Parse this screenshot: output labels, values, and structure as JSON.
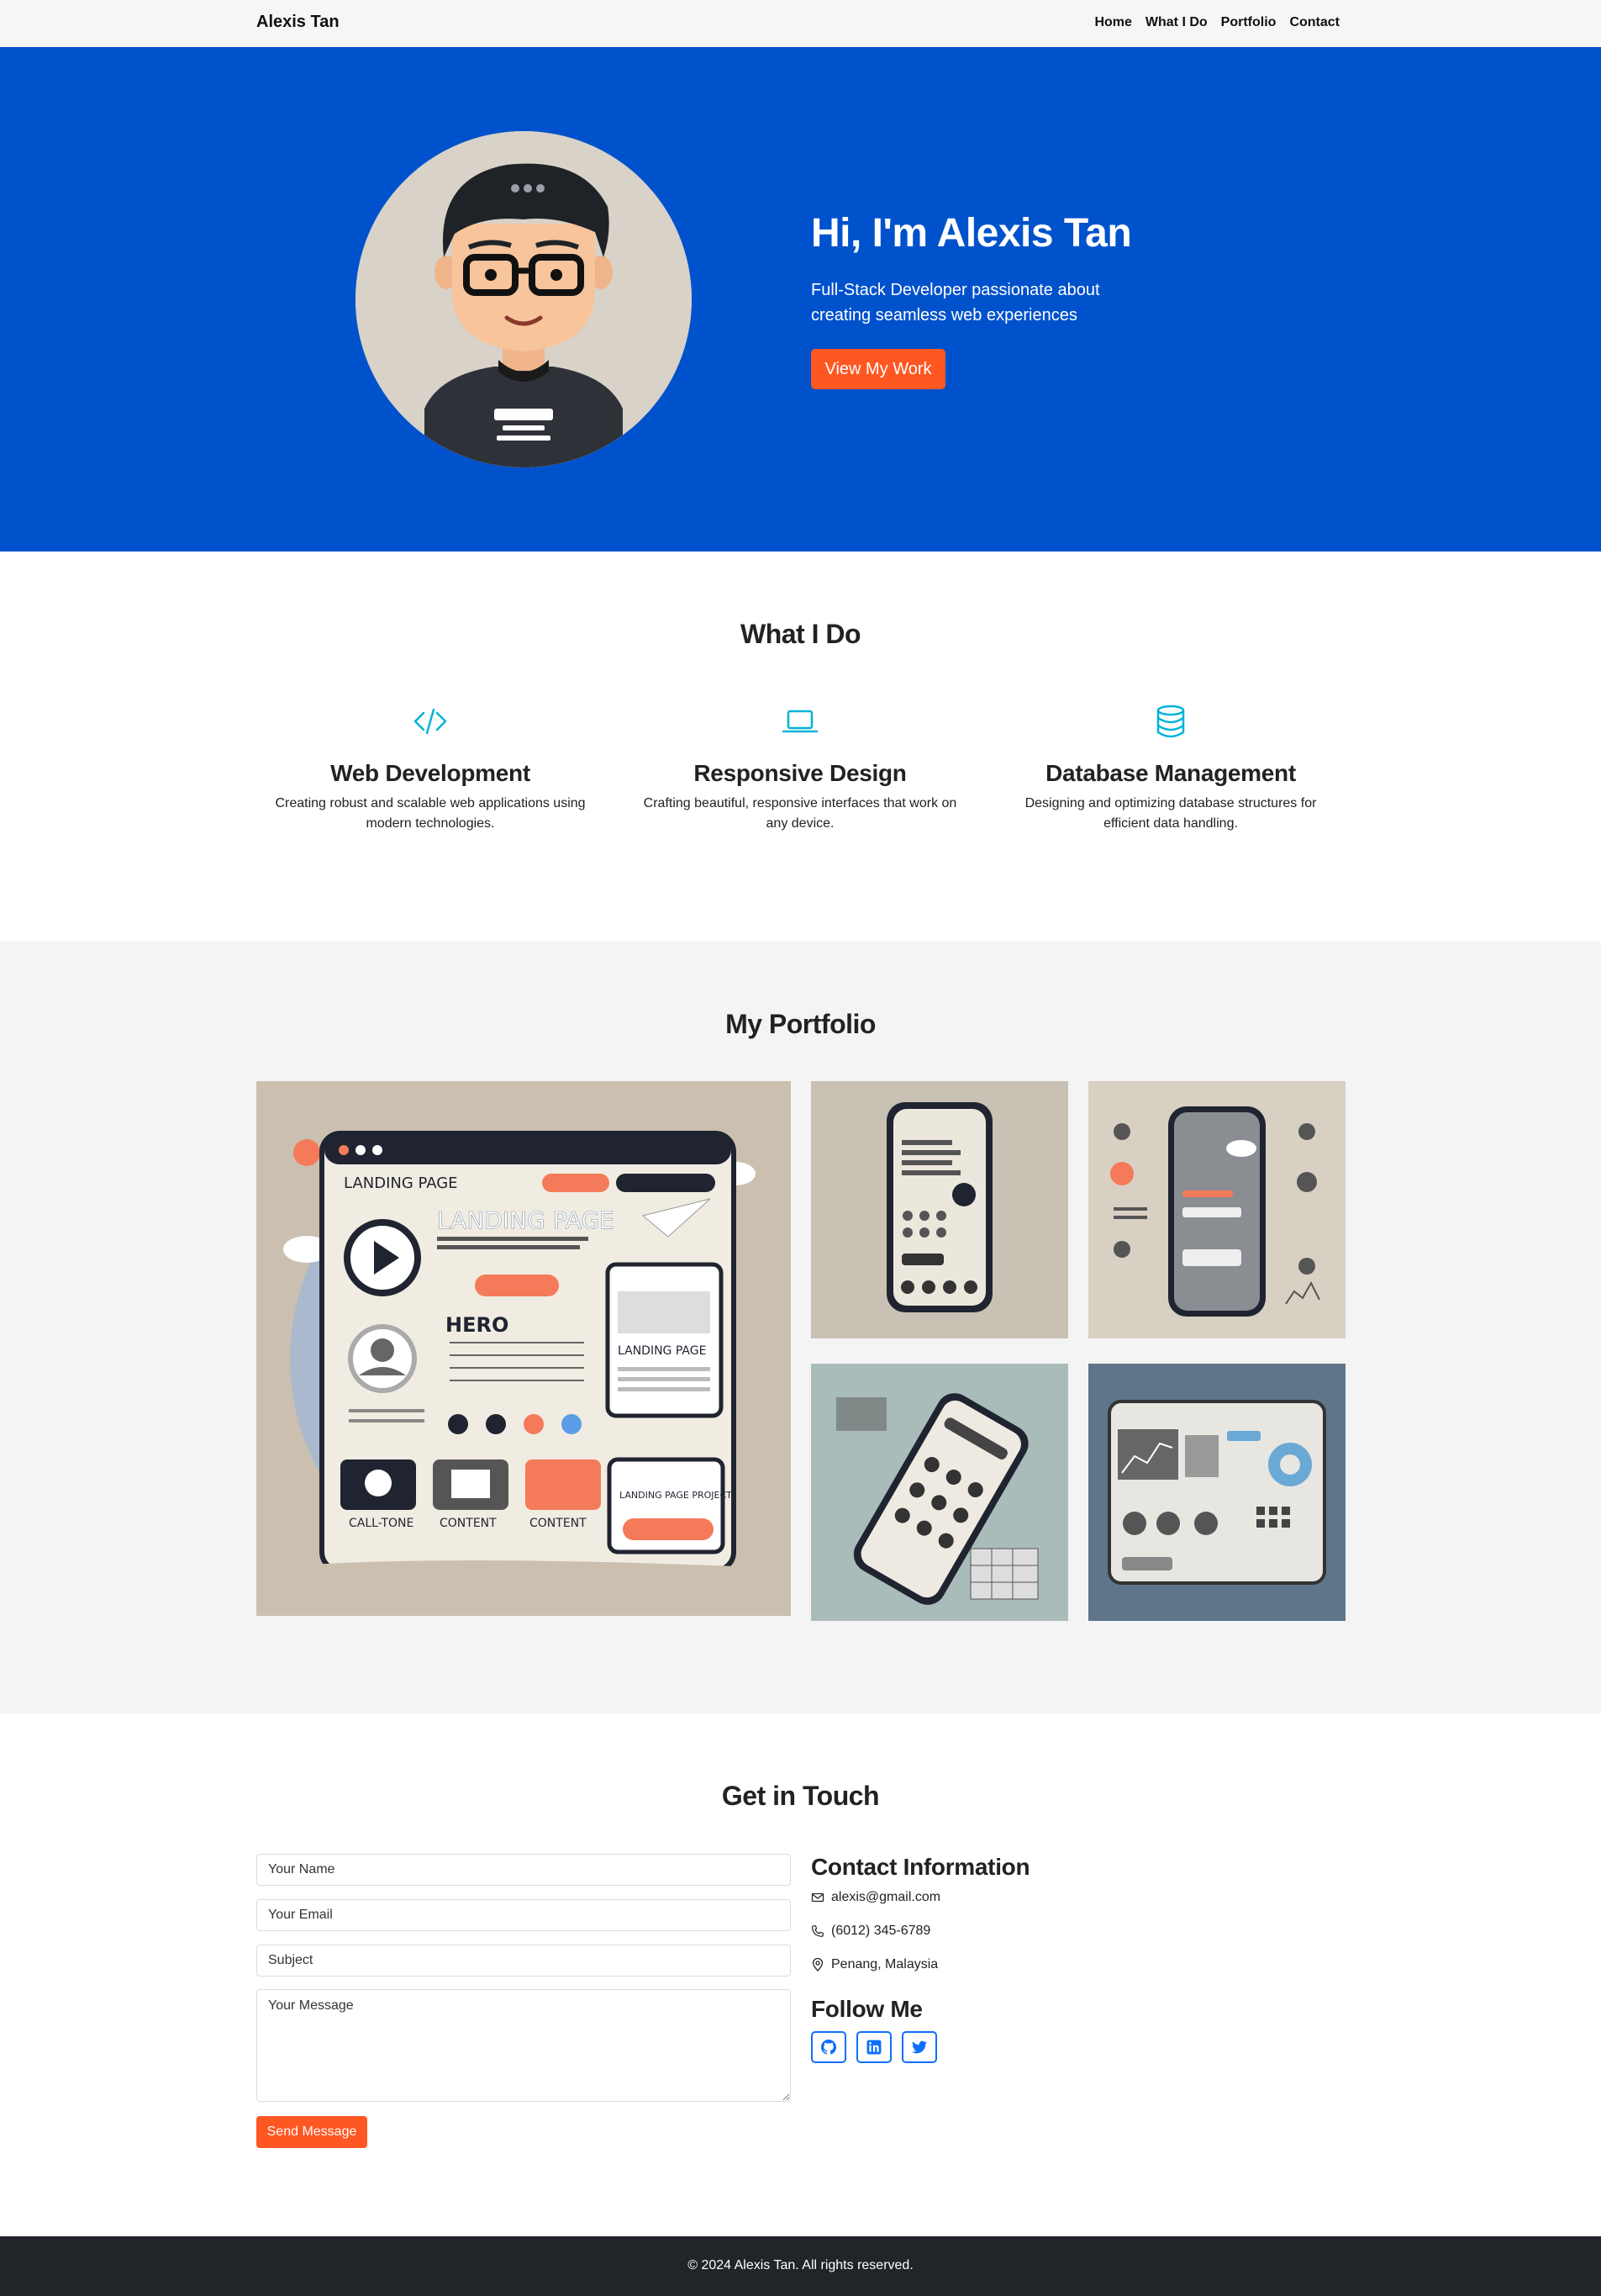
{
  "nav": {
    "brand": "Alexis Tan",
    "links": [
      "Home",
      "What I Do",
      "Portfolio",
      "Contact"
    ]
  },
  "hero": {
    "title": "Hi, I'm Alexis Tan",
    "subtitle": "Full-Stack Developer passionate about creating seamless web experiences",
    "button": "View My Work",
    "avatar_icon": "developer-avatar-illustration"
  },
  "services": {
    "title": "What I Do",
    "items": [
      {
        "icon": "code-icon",
        "title": "Web Development",
        "text": "Creating robust and scalable web applications using modern technologies."
      },
      {
        "icon": "laptop-icon",
        "title": "Responsive Design",
        "text": "Crafting beautiful, responsive interfaces that work on any device."
      },
      {
        "icon": "database-icon",
        "title": "Database Management",
        "text": "Designing and optimizing database structures for efficient data handling."
      }
    ]
  },
  "portfolio": {
    "title": "My Portfolio",
    "items": [
      {
        "name": "landing-page-project",
        "text": [
          "LANDING PAGE",
          "HERO",
          "CONTENT",
          "CONTENT",
          "LANDING PAGE PROJECT"
        ]
      },
      {
        "name": "mobile-app-ui-1",
        "text": []
      },
      {
        "name": "mobile-app-ui-2",
        "text": []
      },
      {
        "name": "mobile-app-ui-3",
        "text": []
      },
      {
        "name": "dashboard-ui",
        "text": []
      }
    ]
  },
  "contact": {
    "title": "Get in Touch",
    "form": {
      "name_placeholder": "Your Name",
      "email_placeholder": "Your Email",
      "subject_placeholder": "Subject",
      "message_placeholder": "Your Message",
      "submit": "Send Message"
    },
    "info_title": "Contact Information",
    "email": "alexis@gmail.com",
    "phone": "(6012) 345-6789",
    "location": "Penang, Malaysia",
    "follow_title": "Follow Me",
    "socials": [
      "github-icon",
      "linkedin-icon",
      "twitter-icon"
    ]
  },
  "footer": {
    "copyright": "© 2024 Alexis Tan. All rights reserved."
  },
  "colors": {
    "hero_blue": "#0052cc",
    "accent_orange": "#ff5722",
    "icon_teal": "#00b4d8",
    "link_blue": "#0d6efd",
    "footer_dark": "#212529"
  }
}
